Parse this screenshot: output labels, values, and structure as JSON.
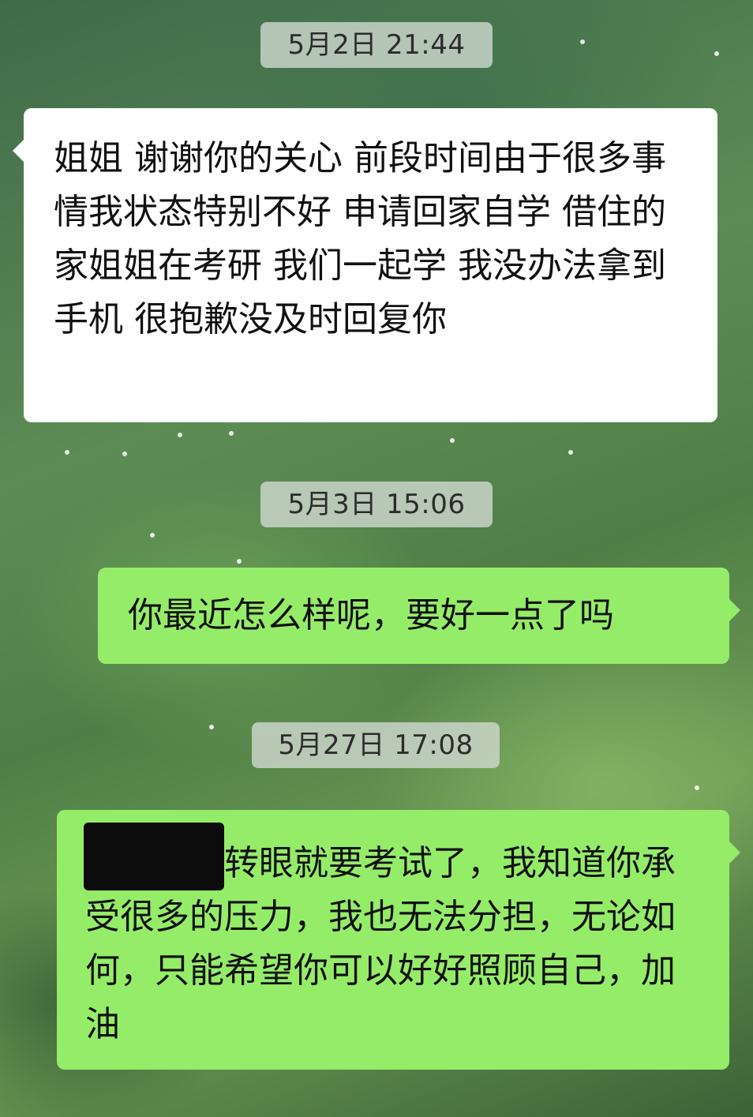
{
  "chat": {
    "timestamps": {
      "t1": "5月2日 21:44",
      "t2": "5月3日 15:06",
      "t3": "5月27日 17:08"
    },
    "messages": {
      "m1": "姐姐 谢谢你的关心 前段时间由于很多事情我状态特别不好 申请回家自学 借住的家姐姐在考研 我们一起学 我没办法拿到手机 很抱歉没及时回复你",
      "m2": "你最近怎么样呢，要好一点了吗",
      "m3": "转眼就要考试了，我知道你承受很多的压力，我也无法分担，无论如何，只能希望你可以好好照顾自己，加油"
    }
  }
}
